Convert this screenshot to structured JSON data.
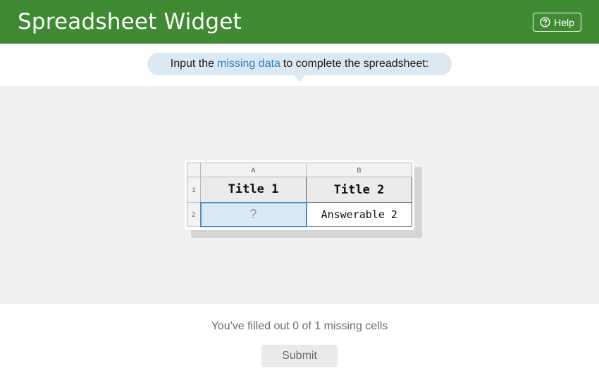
{
  "header": {
    "title": "Spreadsheet Widget",
    "help_label": "Help",
    "help_icon": "question-circle-icon",
    "background": "#3f8a33"
  },
  "instruction": {
    "prefix": "Input the",
    "highlight": "missing data",
    "suffix": "to complete the spreadsheet:",
    "highlight_color": "#2f7fbf"
  },
  "spreadsheet": {
    "columns": [
      "A",
      "B"
    ],
    "row_numbers": [
      "1",
      "2"
    ],
    "rows": [
      [
        "Title 1",
        "Title 2"
      ],
      [
        "?",
        "Answerable 2"
      ]
    ],
    "missing_color": "#dae8f3"
  },
  "status": {
    "text": "You've filled out 0 of 1 missing cells"
  },
  "submit": {
    "label": "Submit"
  }
}
